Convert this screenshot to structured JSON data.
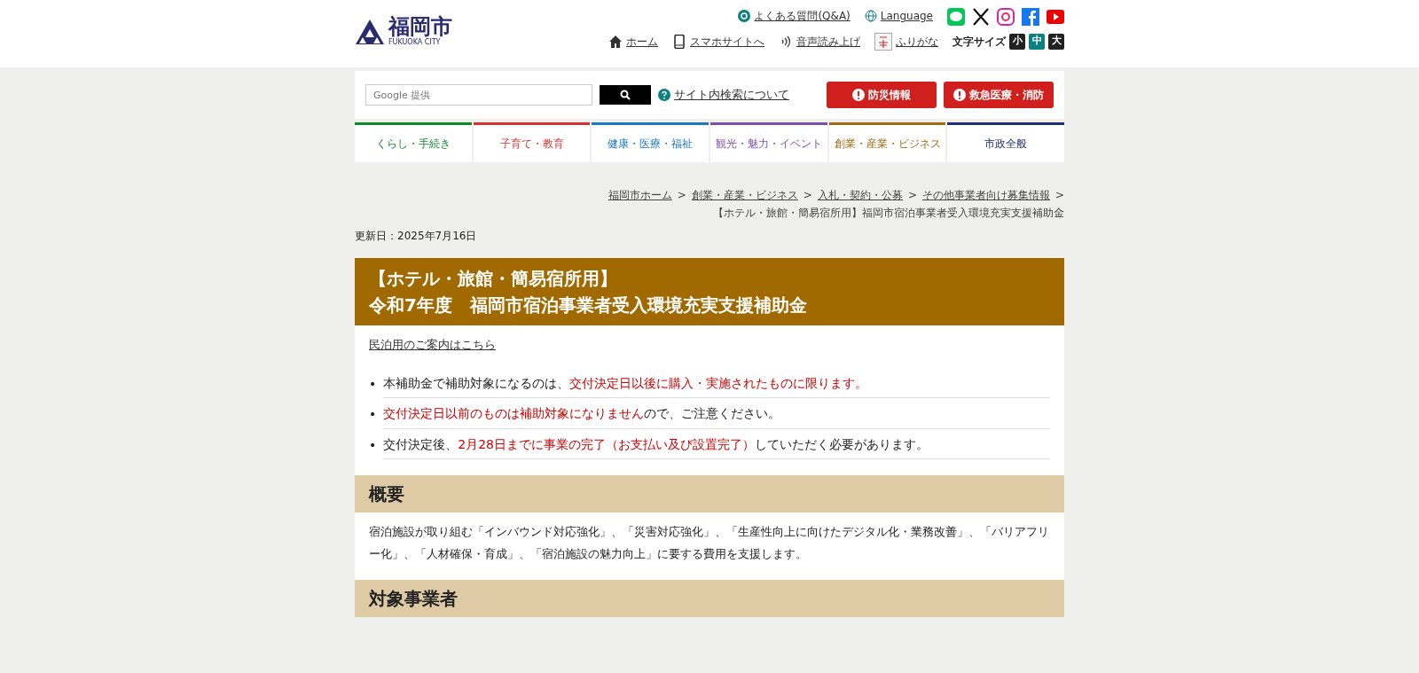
{
  "header": {
    "logo_title": "福岡市",
    "logo_subtitle": "FUKUOKA CITY",
    "top_links": [
      {
        "kind": "faq",
        "label": "よくある質問(Q&A)"
      },
      {
        "kind": "language",
        "label": "Language"
      }
    ],
    "social": [
      {
        "kind": "line"
      },
      {
        "kind": "x"
      },
      {
        "kind": "instagram"
      },
      {
        "kind": "facebook"
      },
      {
        "kind": "youtube"
      }
    ],
    "utility_links": [
      {
        "kind": "home",
        "label": "ホーム"
      },
      {
        "kind": "phone",
        "label": "スマホサイトへ"
      },
      {
        "kind": "voice",
        "label": "音声読み上げ"
      },
      {
        "kind": "furigana",
        "label": "ふりがな"
      }
    ],
    "text_size": {
      "label": "文字サイズ",
      "options": [
        {
          "label": "小",
          "selected": false
        },
        {
          "label": "中",
          "selected": true
        },
        {
          "label": "大",
          "selected": false
        }
      ]
    }
  },
  "search": {
    "placeholder": "Google 提供",
    "help_link": "サイト内検索について"
  },
  "alert_buttons": [
    "防災情報",
    "救急医療・消防"
  ],
  "nav": [
    {
      "label": "くらし・手続き",
      "color": "#13872e"
    },
    {
      "label": "子育て・教育",
      "color": "#d63030"
    },
    {
      "label": "健康・医療・福祉",
      "color": "#1a78c2"
    },
    {
      "label": "観光・魅力・イベント",
      "color": "#7c4fa8"
    },
    {
      "label": "創業・産業・ビジネス",
      "color": "#a06a10"
    },
    {
      "label": "市政全般",
      "color": "#1d2f6e"
    }
  ],
  "breadcrumb": {
    "links": [
      {
        "label": "福岡市ホーム",
        "separator": ">"
      },
      {
        "label": "創業・産業・ビジネス",
        "separator": ">"
      },
      {
        "label": "入札・契約・公募",
        "separator": ">"
      },
      {
        "label": "その他事業者向け募集情報",
        "separator": ">"
      }
    ],
    "current": "【ホテル・旅館・簡易宿所用】福岡市宿泊事業者受入環境充実支援補助金"
  },
  "updated": "更新日：2025年7月16日",
  "title_lines": [
    "【ホテル・旅館・簡易宿所用】",
    "令和7年度　福岡市宿泊事業者受入環境充実支援補助金"
  ],
  "intro_link": "民泊用のご案内はこちら",
  "notices": [
    {
      "marker": "•",
      "segments": [
        {
          "text": "本補助金で補助対象になるのは、",
          "emphasis": false
        },
        {
          "text": "交付決定日以後に購入・実施されたものに限ります。",
          "emphasis": true
        }
      ]
    },
    {
      "marker": "•",
      "segments": [
        {
          "text": "交付決定日以前のものは補助対象になりません",
          "emphasis": true
        },
        {
          "text": "ので、ご注意ください。",
          "emphasis": false
        }
      ]
    },
    {
      "marker": "•",
      "segments": [
        {
          "text": "交付決定後、",
          "emphasis": false
        },
        {
          "text": "2月28日までに事業の完了（お支払い及び設置完了）",
          "emphasis": true
        },
        {
          "text": "していただく必要があります。",
          "emphasis": false
        }
      ]
    }
  ],
  "sections": [
    {
      "heading": "概要",
      "body": "宿泊施設が取り組む「インバウンド対応強化」、「災害対応強化」、「生産性向上に向けたデジタル化・業務改善」、「バリアフリー化」、「人材確保・育成」、「宿泊施設の魅力向上」に要する費用を支援します。"
    },
    {
      "heading": "対象事業者"
    }
  ]
}
